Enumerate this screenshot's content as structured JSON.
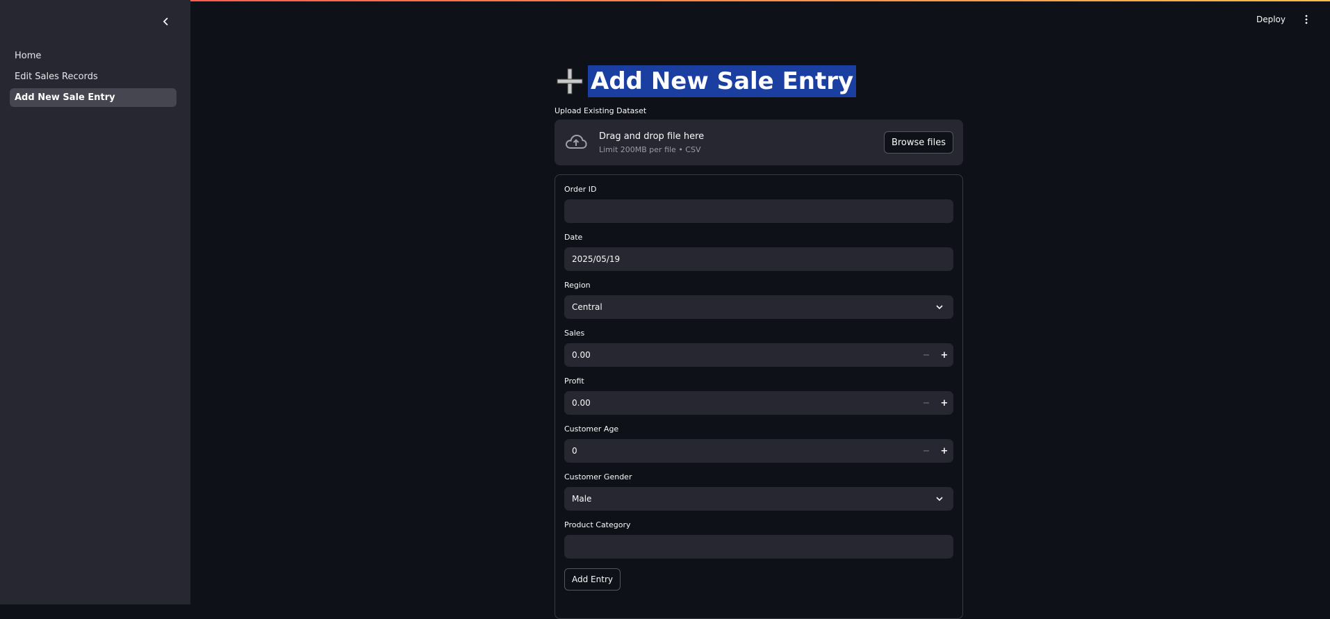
{
  "header": {
    "deploy_label": "Deploy",
    "menu_icon": "more-vertical-icon"
  },
  "sidebar": {
    "collapse_icon": "chevron-left-icon",
    "items": [
      {
        "label": "Home",
        "active": false
      },
      {
        "label": "Edit Sales Records",
        "active": false
      },
      {
        "label": "Add New Sale Entry",
        "active": true
      }
    ]
  },
  "page": {
    "title": "Add New Sale Entry",
    "title_icon": "plus-icon"
  },
  "uploader": {
    "label": "Upload Existing Dataset",
    "drop_text": "Drag and drop file here",
    "limit_text": "Limit 200MB per file • CSV",
    "browse_label": "Browse files"
  },
  "form": {
    "order_id": {
      "label": "Order ID",
      "value": ""
    },
    "date": {
      "label": "Date",
      "value": "2025/05/19"
    },
    "region": {
      "label": "Region",
      "value": "Central"
    },
    "sales": {
      "label": "Sales",
      "value": "0.00"
    },
    "profit": {
      "label": "Profit",
      "value": "0.00"
    },
    "customer_age": {
      "label": "Customer Age",
      "value": "0"
    },
    "customer_gender": {
      "label": "Customer Gender",
      "value": "Male"
    },
    "product_category": {
      "label": "Product Category",
      "value": ""
    },
    "stepper_minus": "−",
    "stepper_plus": "+",
    "submit_label": "Add Entry"
  },
  "colors": {
    "background": "#0e1117",
    "sidebar": "#262730",
    "input": "#262730",
    "title_highlight": "#1a3fa0"
  }
}
